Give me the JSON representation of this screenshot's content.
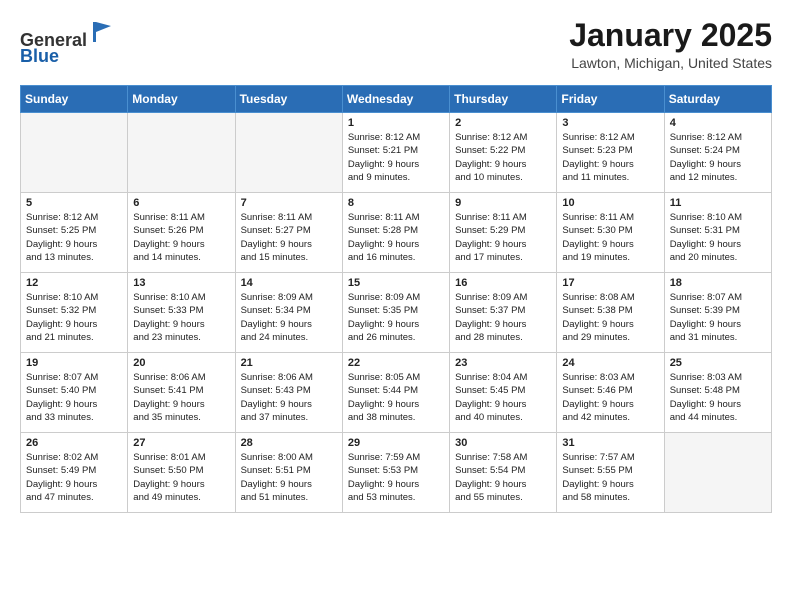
{
  "header": {
    "logo_general": "General",
    "logo_blue": "Blue",
    "title": "January 2025",
    "subtitle": "Lawton, Michigan, United States"
  },
  "weekdays": [
    "Sunday",
    "Monday",
    "Tuesday",
    "Wednesday",
    "Thursday",
    "Friday",
    "Saturday"
  ],
  "weeks": [
    [
      {
        "day": "",
        "info": ""
      },
      {
        "day": "",
        "info": ""
      },
      {
        "day": "",
        "info": ""
      },
      {
        "day": "1",
        "info": "Sunrise: 8:12 AM\nSunset: 5:21 PM\nDaylight: 9 hours\nand 9 minutes."
      },
      {
        "day": "2",
        "info": "Sunrise: 8:12 AM\nSunset: 5:22 PM\nDaylight: 9 hours\nand 10 minutes."
      },
      {
        "day": "3",
        "info": "Sunrise: 8:12 AM\nSunset: 5:23 PM\nDaylight: 9 hours\nand 11 minutes."
      },
      {
        "day": "4",
        "info": "Sunrise: 8:12 AM\nSunset: 5:24 PM\nDaylight: 9 hours\nand 12 minutes."
      }
    ],
    [
      {
        "day": "5",
        "info": "Sunrise: 8:12 AM\nSunset: 5:25 PM\nDaylight: 9 hours\nand 13 minutes."
      },
      {
        "day": "6",
        "info": "Sunrise: 8:11 AM\nSunset: 5:26 PM\nDaylight: 9 hours\nand 14 minutes."
      },
      {
        "day": "7",
        "info": "Sunrise: 8:11 AM\nSunset: 5:27 PM\nDaylight: 9 hours\nand 15 minutes."
      },
      {
        "day": "8",
        "info": "Sunrise: 8:11 AM\nSunset: 5:28 PM\nDaylight: 9 hours\nand 16 minutes."
      },
      {
        "day": "9",
        "info": "Sunrise: 8:11 AM\nSunset: 5:29 PM\nDaylight: 9 hours\nand 17 minutes."
      },
      {
        "day": "10",
        "info": "Sunrise: 8:11 AM\nSunset: 5:30 PM\nDaylight: 9 hours\nand 19 minutes."
      },
      {
        "day": "11",
        "info": "Sunrise: 8:10 AM\nSunset: 5:31 PM\nDaylight: 9 hours\nand 20 minutes."
      }
    ],
    [
      {
        "day": "12",
        "info": "Sunrise: 8:10 AM\nSunset: 5:32 PM\nDaylight: 9 hours\nand 21 minutes."
      },
      {
        "day": "13",
        "info": "Sunrise: 8:10 AM\nSunset: 5:33 PM\nDaylight: 9 hours\nand 23 minutes."
      },
      {
        "day": "14",
        "info": "Sunrise: 8:09 AM\nSunset: 5:34 PM\nDaylight: 9 hours\nand 24 minutes."
      },
      {
        "day": "15",
        "info": "Sunrise: 8:09 AM\nSunset: 5:35 PM\nDaylight: 9 hours\nand 26 minutes."
      },
      {
        "day": "16",
        "info": "Sunrise: 8:09 AM\nSunset: 5:37 PM\nDaylight: 9 hours\nand 28 minutes."
      },
      {
        "day": "17",
        "info": "Sunrise: 8:08 AM\nSunset: 5:38 PM\nDaylight: 9 hours\nand 29 minutes."
      },
      {
        "day": "18",
        "info": "Sunrise: 8:07 AM\nSunset: 5:39 PM\nDaylight: 9 hours\nand 31 minutes."
      }
    ],
    [
      {
        "day": "19",
        "info": "Sunrise: 8:07 AM\nSunset: 5:40 PM\nDaylight: 9 hours\nand 33 minutes."
      },
      {
        "day": "20",
        "info": "Sunrise: 8:06 AM\nSunset: 5:41 PM\nDaylight: 9 hours\nand 35 minutes."
      },
      {
        "day": "21",
        "info": "Sunrise: 8:06 AM\nSunset: 5:43 PM\nDaylight: 9 hours\nand 37 minutes."
      },
      {
        "day": "22",
        "info": "Sunrise: 8:05 AM\nSunset: 5:44 PM\nDaylight: 9 hours\nand 38 minutes."
      },
      {
        "day": "23",
        "info": "Sunrise: 8:04 AM\nSunset: 5:45 PM\nDaylight: 9 hours\nand 40 minutes."
      },
      {
        "day": "24",
        "info": "Sunrise: 8:03 AM\nSunset: 5:46 PM\nDaylight: 9 hours\nand 42 minutes."
      },
      {
        "day": "25",
        "info": "Sunrise: 8:03 AM\nSunset: 5:48 PM\nDaylight: 9 hours\nand 44 minutes."
      }
    ],
    [
      {
        "day": "26",
        "info": "Sunrise: 8:02 AM\nSunset: 5:49 PM\nDaylight: 9 hours\nand 47 minutes."
      },
      {
        "day": "27",
        "info": "Sunrise: 8:01 AM\nSunset: 5:50 PM\nDaylight: 9 hours\nand 49 minutes."
      },
      {
        "day": "28",
        "info": "Sunrise: 8:00 AM\nSunset: 5:51 PM\nDaylight: 9 hours\nand 51 minutes."
      },
      {
        "day": "29",
        "info": "Sunrise: 7:59 AM\nSunset: 5:53 PM\nDaylight: 9 hours\nand 53 minutes."
      },
      {
        "day": "30",
        "info": "Sunrise: 7:58 AM\nSunset: 5:54 PM\nDaylight: 9 hours\nand 55 minutes."
      },
      {
        "day": "31",
        "info": "Sunrise: 7:57 AM\nSunset: 5:55 PM\nDaylight: 9 hours\nand 58 minutes."
      },
      {
        "day": "",
        "info": ""
      }
    ]
  ]
}
